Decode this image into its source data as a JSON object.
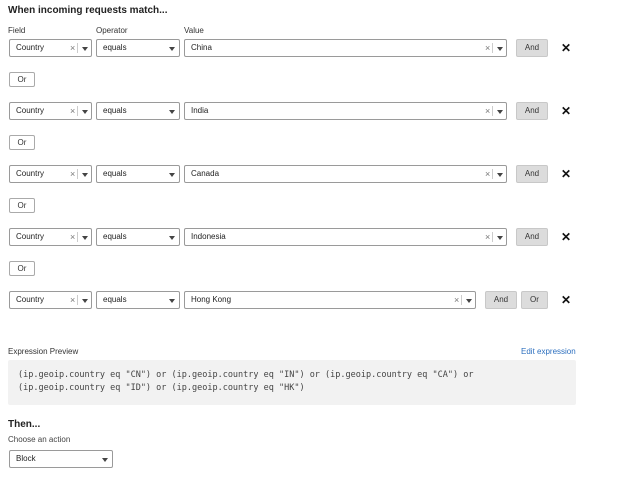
{
  "header": {
    "title": "When incoming requests match..."
  },
  "columns": {
    "field": "Field",
    "operator": "Operator",
    "value": "Value"
  },
  "clear_glyph": "×",
  "rows": [
    {
      "field": "Country",
      "operator": "equals",
      "value": "China",
      "and_label": "And"
    },
    {
      "field": "Country",
      "operator": "equals",
      "value": "India",
      "and_label": "And"
    },
    {
      "field": "Country",
      "operator": "equals",
      "value": "Canada",
      "and_label": "And"
    },
    {
      "field": "Country",
      "operator": "equals",
      "value": "Indonesia",
      "and_label": "And"
    },
    {
      "field": "Country",
      "operator": "equals",
      "value": "Hong Kong",
      "and_label": "And",
      "or_label": "Or"
    }
  ],
  "or_separators": [
    "Or",
    "Or",
    "Or",
    "Or"
  ],
  "delete_glyph": "✕",
  "expression": {
    "label": "Expression Preview",
    "edit_link": "Edit expression",
    "text": "(ip.geoip.country eq \"CN\") or (ip.geoip.country eq \"IN\") or (ip.geoip.country eq \"CA\") or\n(ip.geoip.country eq \"ID\") or (ip.geoip.country eq \"HK\")"
  },
  "then": {
    "title": "Then...",
    "action_label": "Choose an action",
    "action_value": "Block"
  }
}
